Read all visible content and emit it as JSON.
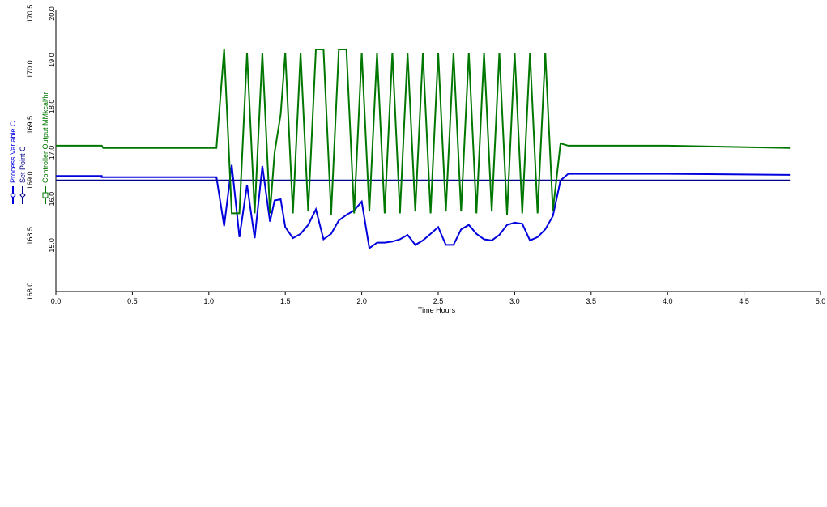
{
  "chart_data": {
    "type": "line",
    "xlabel": "Time Hours",
    "xlim": [
      0.0,
      5.0
    ],
    "x_ticks": [
      "0.0",
      "0.5",
      "1.0",
      "1.5",
      "2.0",
      "2.5",
      "3.0",
      "3.5",
      "4.0",
      "4.5",
      "5.0"
    ],
    "axes": [
      {
        "id": "left",
        "titles": [
          "Process Variable C",
          "Set Point C"
        ],
        "ylim": [
          168.0,
          170.5
        ],
        "ticks": [
          "168.0",
          "168.5",
          "169.0",
          "169.5",
          "170.0",
          "170.5"
        ]
      },
      {
        "id": "right",
        "titles": [
          "Controller Output MMkcal/hr"
        ],
        "ylim": [
          14.0,
          20.0
        ],
        "ticks": [
          "15.0",
          "16.0",
          "17.0",
          "18.0",
          "19.0",
          "20.0"
        ]
      }
    ],
    "series": [
      {
        "name": "Process Variable C",
        "axis": "left",
        "color": "#0000dd",
        "x": [
          0.0,
          0.3,
          0.3,
          1.05,
          1.1,
          1.15,
          1.2,
          1.25,
          1.3,
          1.35,
          1.4,
          1.43,
          1.47,
          1.5,
          1.55,
          1.6,
          1.65,
          1.7,
          1.75,
          1.8,
          1.85,
          1.9,
          1.95,
          2.0,
          2.05,
          2.1,
          2.15,
          2.2,
          2.25,
          2.3,
          2.35,
          2.4,
          2.45,
          2.5,
          2.55,
          2.6,
          2.65,
          2.7,
          2.75,
          2.8,
          2.85,
          2.9,
          2.95,
          3.0,
          3.05,
          3.1,
          3.15,
          3.2,
          3.25,
          3.3,
          3.35,
          3.4,
          4.0,
          4.8
        ],
        "y": [
          169.04,
          169.04,
          169.03,
          169.03,
          168.59,
          169.14,
          168.49,
          168.96,
          168.48,
          169.13,
          168.63,
          168.82,
          168.83,
          168.58,
          168.48,
          168.52,
          168.6,
          168.74,
          168.47,
          168.52,
          168.64,
          168.69,
          168.73,
          168.81,
          168.39,
          168.44,
          168.44,
          168.45,
          168.47,
          168.51,
          168.42,
          168.46,
          168.52,
          168.58,
          168.42,
          168.42,
          168.56,
          168.6,
          168.52,
          168.47,
          168.46,
          168.51,
          168.6,
          168.62,
          168.61,
          168.46,
          168.49,
          168.56,
          168.68,
          169.0,
          169.06,
          169.06,
          169.06,
          169.05
        ]
      },
      {
        "name": "Set Point C",
        "axis": "left",
        "color": "#00008b",
        "x": [
          0.0,
          4.8
        ],
        "y": [
          169.0,
          169.0
        ]
      },
      {
        "name": "Controller Output MMkcal/hr",
        "axis": "right",
        "color": "#007700",
        "x": [
          0.0,
          0.3,
          0.31,
          1.05,
          1.1,
          1.15,
          1.2,
          1.25,
          1.3,
          1.35,
          1.4,
          1.43,
          1.47,
          1.5,
          1.55,
          1.6,
          1.65,
          1.7,
          1.75,
          1.8,
          1.85,
          1.9,
          1.95,
          2.0,
          2.05,
          2.1,
          2.15,
          2.2,
          2.25,
          2.3,
          2.35,
          2.4,
          2.45,
          2.5,
          2.55,
          2.6,
          2.65,
          2.7,
          2.75,
          2.8,
          2.85,
          2.9,
          2.95,
          3.0,
          3.05,
          3.1,
          3.15,
          3.2,
          3.25,
          3.3,
          3.35,
          3.4,
          4.0,
          4.8
        ],
        "y": [
          17.15,
          17.15,
          17.1,
          17.1,
          19.23,
          15.69,
          15.69,
          19.16,
          15.69,
          19.16,
          15.69,
          17.0,
          17.83,
          19.16,
          15.69,
          19.16,
          15.73,
          19.23,
          19.23,
          15.66,
          19.23,
          19.23,
          15.69,
          19.16,
          15.73,
          19.16,
          15.69,
          19.16,
          15.69,
          19.16,
          15.73,
          19.16,
          15.69,
          19.16,
          15.73,
          19.16,
          15.73,
          19.16,
          15.69,
          19.16,
          15.73,
          19.16,
          15.66,
          19.16,
          15.69,
          19.16,
          15.69,
          19.16,
          15.75,
          17.2,
          17.15,
          17.15,
          17.15,
          17.1
        ]
      }
    ],
    "grid": false,
    "legend": "left-vertical"
  }
}
